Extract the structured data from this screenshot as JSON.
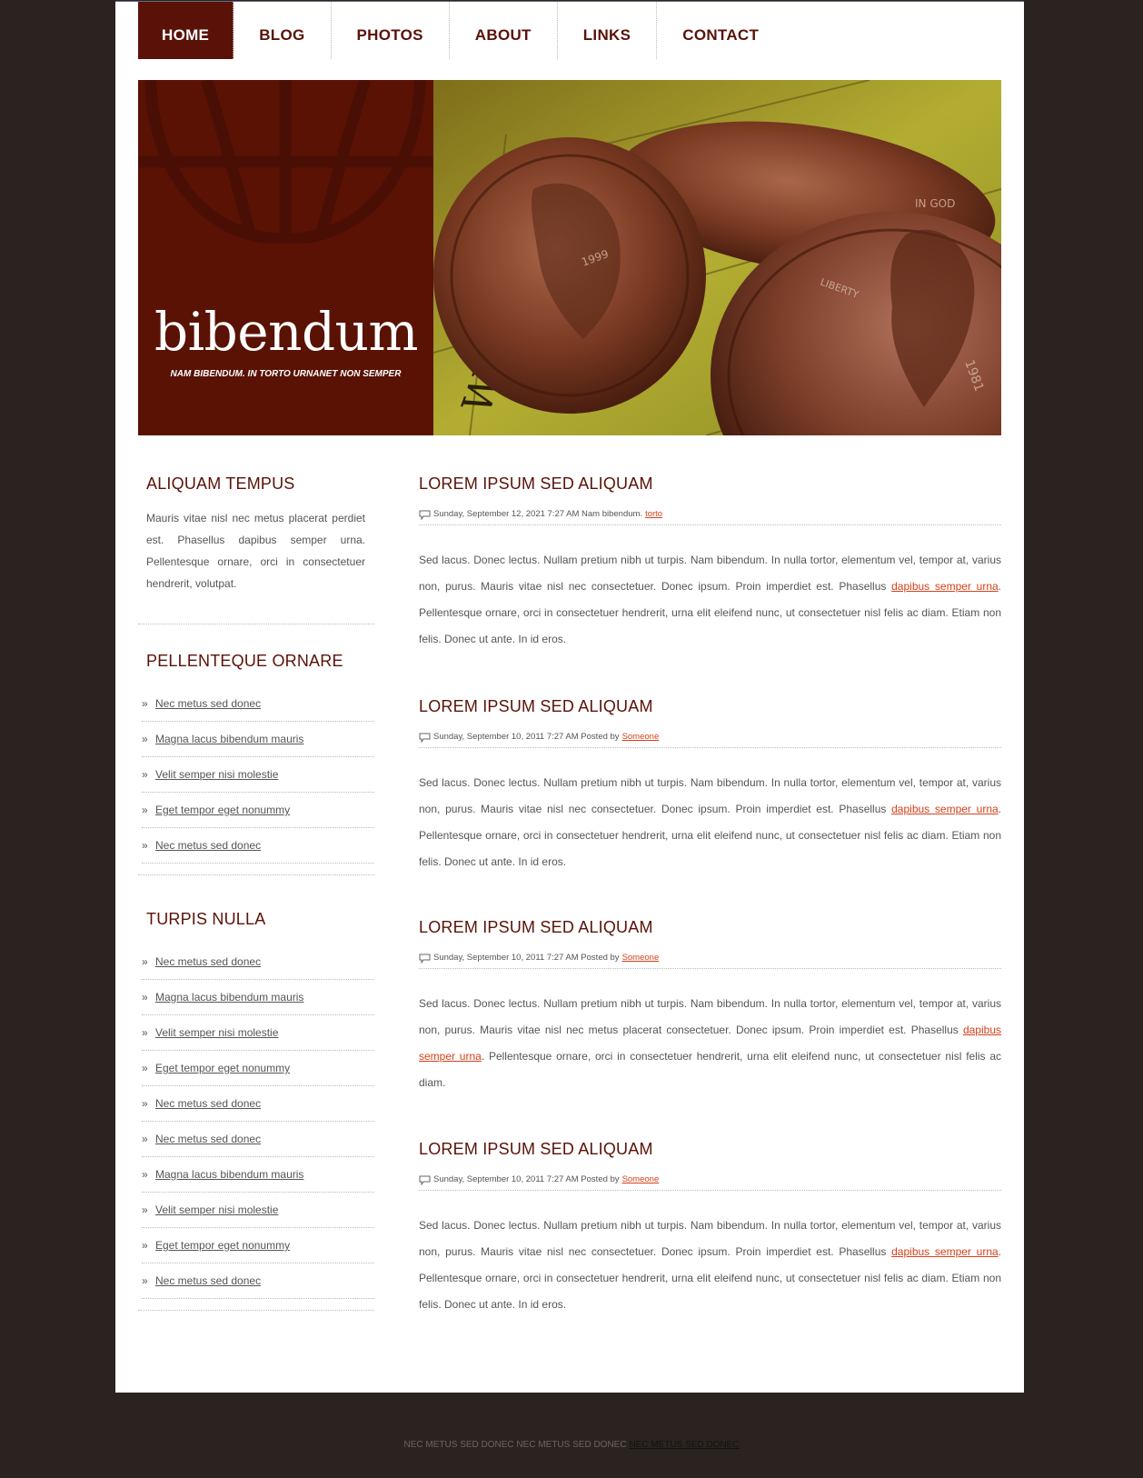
{
  "nav": {
    "items": [
      "HOME",
      "BLOG",
      "PHOTOS",
      "ABOUT",
      "LINKS",
      "CONTACT"
    ],
    "active": "HOME"
  },
  "banner": {
    "title": "bibendum",
    "tagline": "NAM BIBENDUM. IN TORTO URNANET NON SEMPER"
  },
  "sidebar": {
    "about": {
      "heading": "ALIQUAM TEMPUS",
      "text": "Mauris vitae nisl nec metus placerat perdiet est. Phasellus dapibus semper urna. Pellentesque ornare, orci in consectetuer hendrerit, volutpat."
    },
    "list1": {
      "heading": "PELLENTEQUE ORNARE",
      "bullet": "»",
      "items": [
        "Nec metus sed donec",
        "Magna lacus bibendum mauris",
        "Velit semper nisi molestie",
        "Eget tempor eget nonummy",
        "Nec metus sed donec"
      ]
    },
    "list2": {
      "heading": "TURPIS NULLA",
      "bullet": "»",
      "items": [
        "Nec metus sed donec",
        "Magna lacus bibendum mauris",
        "Velit semper nisi molestie",
        "Eget tempor eget nonummy",
        "Nec metus sed donec",
        "Nec metus sed donec",
        "Magna lacus bibendum mauris",
        "Velit semper nisi molestie",
        "Eget tempor eget nonummy",
        "Nec metus sed donec"
      ]
    }
  },
  "posts": [
    {
      "title": "LOREM IPSUM SED ALIQUAM",
      "meta": "Sunday, September 12, 2021 7:27 AM Nam bibendum.",
      "meta_link": "torto",
      "body_before": "Sed lacus. Donec lectus. Nullam pretium nibh ut turpis. Nam bibendum. In nulla tortor, elementum vel, tempor at, varius non, purus. Mauris vitae nisl nec consectetuer. Donec ipsum. Proin imperdiet est. Phasellus ",
      "body_link": "dapibus semper urna",
      "body_after": ". Pellentesque ornare, orci in consectetuer hendrerit, urna elit eleifend nunc, ut consectetuer nisl felis ac diam. Etiam non felis. Donec ut ante. In id eros."
    },
    {
      "title": "LOREM IPSUM SED ALIQUAM",
      "meta": "Sunday, September 10, 2011 7:27 AM Posted by",
      "meta_link": "Someone",
      "body_before": "Sed lacus. Donec lectus. Nullam pretium nibh ut turpis. Nam bibendum. In nulla tortor, elementum vel, tempor at, varius non, purus. Mauris vitae nisl nec consectetuer. Donec ipsum. Proin imperdiet est. Phasellus ",
      "body_link": "dapibus semper urna",
      "body_after": ". Pellentesque ornare, orci in consectetuer hendrerit, urna elit eleifend nunc, ut consectetuer nisl felis ac diam. Etiam non felis. Donec ut ante. In id eros."
    },
    {
      "title": "LOREM IPSUM SED ALIQUAM",
      "meta": "Sunday, September 10, 2011 7:27 AM Posted by",
      "meta_link": "Someone",
      "body_before": "Sed lacus. Donec lectus. Nullam pretium nibh ut turpis. Nam bibendum. In nulla tortor, elementum vel, tempor at, varius non, purus. Mauris vitae nisl nec metus placerat consectetuer. Donec ipsum. Proin imperdiet est. Phasellus ",
      "body_link": "dapibus semper urna",
      "body_after": ". Pellentesque ornare, orci in consectetuer hendrerit, urna elit eleifend nunc, ut consectetuer nisl felis ac diam."
    },
    {
      "title": "LOREM IPSUM SED ALIQUAM",
      "meta": "Sunday, September 10, 2011 7:27 AM Posted by",
      "meta_link": "Someone",
      "body_before": "Sed lacus. Donec lectus. Nullam pretium nibh ut turpis. Nam bibendum. In nulla tortor, elementum vel, tempor at, varius non, purus. Mauris vitae nisl nec consectetuer. Donec ipsum. Proin imperdiet est. Phasellus ",
      "body_link": "dapibus semper urna",
      "body_after": ". Pellentesque ornare, orci in consectetuer hendrerit, urna elit eleifend nunc, ut consectetuer nisl felis ac diam. Etiam non felis. Donec ut ante. In id eros."
    }
  ],
  "footer": {
    "text": "NEC METUS SED DONEC NEC METUS SED DONEC",
    "link": "NEC METUS SED DONEC"
  },
  "colors": {
    "brand": "#5a1208",
    "link": "#d4401a",
    "background": "#2a2320"
  },
  "icons": {
    "meta": "comment-icon",
    "banner_watermark": "globe-icon",
    "list_bullet": "double-chevron-right"
  }
}
